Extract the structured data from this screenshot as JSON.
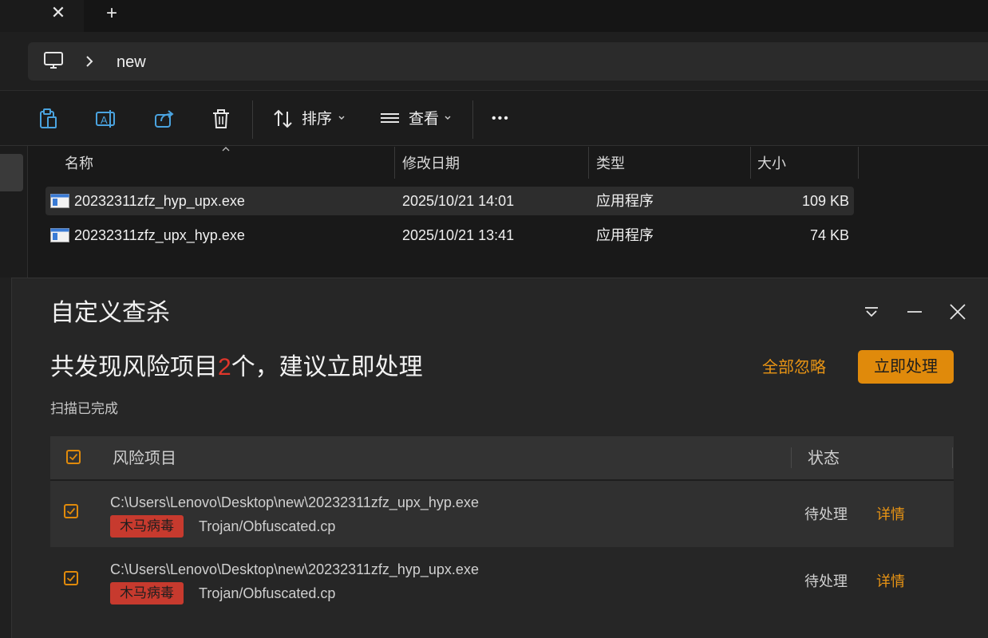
{
  "tabs": {
    "close_glyph": "✕",
    "new_glyph": "+"
  },
  "address": {
    "separator_icon": "chevron-right-icon",
    "path": "new"
  },
  "toolbar": {
    "sort_label": "排序",
    "view_label": "查看",
    "more_label": "•••"
  },
  "file_list": {
    "columns": [
      "名称",
      "修改日期",
      "类型",
      "大小"
    ],
    "rows": [
      {
        "name": "20232311zfz_hyp_upx.exe",
        "date": "2025/10/21 14:01",
        "type": "应用程序",
        "size": "109 KB",
        "selected": true
      },
      {
        "name": "20232311zfz_upx_hyp.exe",
        "date": "2025/10/21 13:41",
        "type": "应用程序",
        "size": "74 KB",
        "selected": false
      }
    ]
  },
  "scan_panel": {
    "title": "自定义查杀",
    "headline_prefix": "共发现风险项目",
    "headline_count": "2",
    "headline_suffix": "个，建议立即处理",
    "status": "扫描已完成",
    "ignore_all_label": "全部忽略",
    "process_now_label": "立即处理",
    "table": {
      "col_risk": "风险项目",
      "col_status": "状态",
      "rows": [
        {
          "path": "C:\\Users\\Lenovo\\Desktop\\new\\20232311zfz_upx_hyp.exe",
          "tag": "木马病毒",
          "threat": "Trojan/Obfuscated.cp",
          "status": "待处理",
          "detail": "详情",
          "checked": true
        },
        {
          "path": "C:\\Users\\Lenovo\\Desktop\\new\\20232311zfz_hyp_upx.exe",
          "tag": "木马病毒",
          "threat": "Trojan/Obfuscated.cp",
          "status": "待处理",
          "detail": "详情",
          "checked": true
        }
      ]
    }
  },
  "colors": {
    "accent_orange": "#e08a0b",
    "danger_red": "#e0362b",
    "tag_red": "#c73a2e",
    "bg_dark": "#202020"
  }
}
